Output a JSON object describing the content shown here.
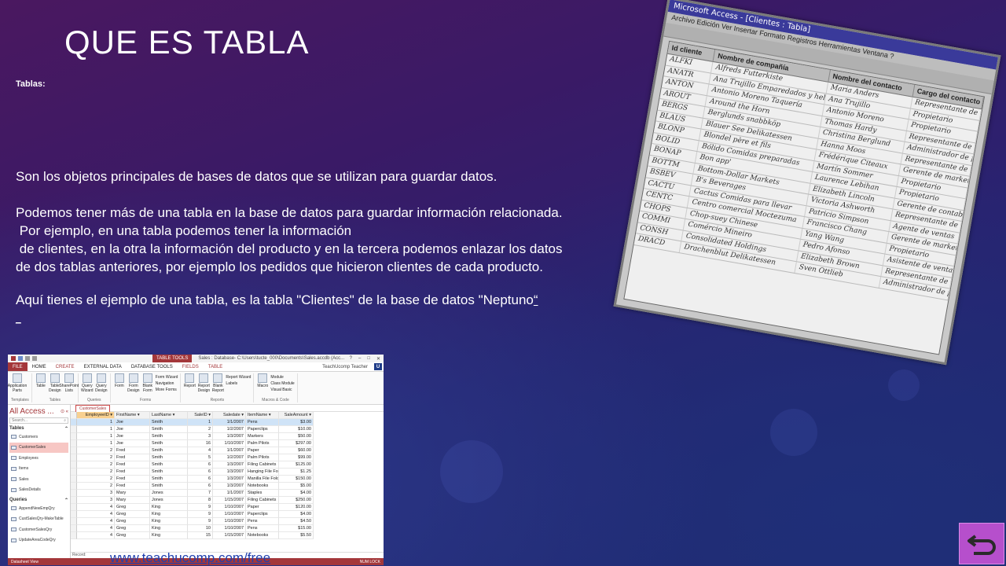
{
  "slide": {
    "title": "QUE ES TABLA",
    "subtitle": "Tablas:",
    "paragraph1": "Son los objetos principales de bases de datos que se utilizan para guardar datos.",
    "paragraph2_lines": [
      "Podemos tener más de una tabla en la base de datos para guardar información relacionada.",
      " Por ejemplo, en una tabla podemos tener la información",
      " de clientes, en la otra la información del producto y en la tercera podemos enlazar los datos",
      "de dos tablas anteriores, por ejemplo los pedidos que hicieron clientes de cada producto."
    ],
    "paragraph3": "Aquí tienes el ejemplo de una tabla, es la tabla \"Clientes\" de la base de datos \"Neptuno",
    "paragraph3_link": "“",
    "trailing_link": "_",
    "watermark": "www.teachucomp.com/free",
    "return_icon": "return-arrow-icon",
    "accent_color": "#b64fcc"
  },
  "old_screenshot": {
    "title": "Microsoft Access - [Clientes : Tabla]",
    "menu": "Archivo  Edición  Ver  Insertar  Formato  Registros  Herramientas  Ventana  ?",
    "headers": [
      "Id cliente",
      "Nombre de compañía",
      "Nombre del contacto",
      "Cargo del contacto"
    ],
    "rows": [
      [
        "ALFKI",
        "Alfreds Futterkiste",
        "Maria Anders",
        "Representante de ventas"
      ],
      [
        "ANATR",
        "Ana Trujillo Emparedados y helados",
        "Ana Trujillo",
        "Propietario"
      ],
      [
        "ANTON",
        "Antonio Moreno Taquería",
        "Antonio Moreno",
        "Propietario"
      ],
      [
        "AROUT",
        "Around the Horn",
        "Thomas Hardy",
        "Representante de ventas"
      ],
      [
        "BERGS",
        "Berglunds snabbköp",
        "Christina Berglund",
        "Administrador de pedidos"
      ],
      [
        "BLAUS",
        "Blauer See Delikatessen",
        "Hanna Moos",
        "Representante de ventas"
      ],
      [
        "BLONP",
        "Blondel père et fils",
        "Frédérique Citeaux",
        "Gerente de marketing"
      ],
      [
        "BOLID",
        "Bólido Comidas preparadas",
        "Martín Sommer",
        "Propietario"
      ],
      [
        "BONAP",
        "Bon app'",
        "Laurence Lebihan",
        "Propietario"
      ],
      [
        "BOTTM",
        "Bottom-Dollar Markets",
        "Elizabeth Lincoln",
        "Gerente de contabilidad"
      ],
      [
        "BSBEV",
        "B's Beverages",
        "Victoria Ashworth",
        "Representante de ventas"
      ],
      [
        "CACTU",
        "Cactus Comidas para llevar",
        "Patricio Simpson",
        "Agente de ventas"
      ],
      [
        "CENTC",
        "Centro comercial Moctezuma",
        "Francisco Chang",
        "Gerente de marketing"
      ],
      [
        "CHOPS",
        "Chop-suey Chinese",
        "Yang Wang",
        "Propietario"
      ],
      [
        "COMMI",
        "Comércio Mineiro",
        "Pedro Afonso",
        "Asistente de ventas"
      ],
      [
        "CONSH",
        "Consolidated Holdings",
        "Elizabeth Brown",
        "Representante de ventas"
      ],
      [
        "DRACD",
        "Drachenblut Delikatessen",
        "Sven Ottlieb",
        "Administrador de pedidos"
      ]
    ]
  },
  "access": {
    "title": "Sales : Database- C:\\Users\\tucte_000\\Documents\\Sales.accdb (Acc...",
    "context_tab": "TABLE TOOLS",
    "tabs": [
      "FILE",
      "HOME",
      "CREATE",
      "EXTERNAL DATA",
      "DATABASE TOOLS",
      "FIELDS",
      "TABLE"
    ],
    "user": "TeachUcomp Teacher",
    "ribbon_groups": [
      {
        "label": "Templates",
        "buttons": [
          "Application Parts"
        ]
      },
      {
        "label": "Tables",
        "buttons": [
          "Table",
          "Table Design",
          "SharePoint Lists"
        ]
      },
      {
        "label": "Queries",
        "buttons": [
          "Query Wizard",
          "Query Design"
        ]
      },
      {
        "label": "Forms",
        "buttons": [
          "Form",
          "Form Design",
          "Blank Form"
        ],
        "small": [
          "Form Wizard",
          "Navigation",
          "More Forms"
        ]
      },
      {
        "label": "Reports",
        "buttons": [
          "Report",
          "Report Design",
          "Blank Report"
        ],
        "small": [
          "Report Wizard",
          "Labels"
        ]
      },
      {
        "label": "Macros & Code",
        "buttons": [
          "Macro"
        ],
        "small": [
          "Module",
          "Class Module",
          "Visual Basic"
        ]
      }
    ],
    "nav": {
      "header": "All Access ...",
      "search": "Search...",
      "tables_label": "Tables",
      "tables": [
        "Customers",
        "CustomerSales",
        "Employees",
        "Items",
        "Sales",
        "SalesDetails"
      ],
      "queries_label": "Queries",
      "queries": [
        "AppendNewEmpQry",
        "CustSalesQry-MakeTable",
        "CustomerSalesQry",
        "UpdateAreaCodeQry"
      ]
    },
    "object_tab": "CustomerSales",
    "columns": [
      "EmployeeID",
      "FirstName",
      "LastName",
      "SaleID",
      "Saledate",
      "ItemName",
      "SaleAmount"
    ],
    "rows": [
      [
        "1",
        "Joe",
        "Smith",
        "1",
        "1/1/2007",
        "Pens",
        "$3.00"
      ],
      [
        "1",
        "Joe",
        "Smith",
        "2",
        "1/2/2007",
        "Paperclips",
        "$10.00"
      ],
      [
        "1",
        "Joe",
        "Smith",
        "3",
        "1/3/2007",
        "Markers",
        "$50.00"
      ],
      [
        "1",
        "Joe",
        "Smith",
        "16",
        "1/10/2007",
        "Palm Pilots",
        "$297.00"
      ],
      [
        "2",
        "Fred",
        "Smith",
        "4",
        "1/1/2007",
        "Paper",
        "$60.00"
      ],
      [
        "2",
        "Fred",
        "Smith",
        "5",
        "1/2/2007",
        "Palm Pilots",
        "$99.00"
      ],
      [
        "2",
        "Fred",
        "Smith",
        "6",
        "1/3/2007",
        "Filing Cabinets",
        "$125.00"
      ],
      [
        "2",
        "Fred",
        "Smith",
        "6",
        "1/3/2007",
        "Hanging File Fol",
        "$1.25"
      ],
      [
        "2",
        "Fred",
        "Smith",
        "6",
        "1/3/2007",
        "Manilla File Folc",
        "$150.00"
      ],
      [
        "2",
        "Fred",
        "Smith",
        "6",
        "1/3/2007",
        "Notebooks",
        "$5.00"
      ],
      [
        "3",
        "Mary",
        "Jones",
        "7",
        "1/1/2007",
        "Staples",
        "$4.00"
      ],
      [
        "3",
        "Mary",
        "Jones",
        "8",
        "1/15/2007",
        "Filing Cabinets",
        "$250.00"
      ],
      [
        "4",
        "Greg",
        "King",
        "9",
        "1/10/2007",
        "Paper",
        "$120.00"
      ],
      [
        "4",
        "Greg",
        "King",
        "9",
        "1/10/2007",
        "Paperclips",
        "$4.00"
      ],
      [
        "4",
        "Greg",
        "King",
        "9",
        "1/10/2007",
        "Pens",
        "$4.50"
      ],
      [
        "4",
        "Greg",
        "King",
        "10",
        "1/10/2007",
        "Pens",
        "$15.00"
      ],
      [
        "4",
        "Greg",
        "King",
        "15",
        "1/15/2007",
        "Notebooks",
        "$5.50"
      ]
    ],
    "record_label": "Record:",
    "status_left": "Datasheet View",
    "status_right": "NUM LOCK"
  }
}
